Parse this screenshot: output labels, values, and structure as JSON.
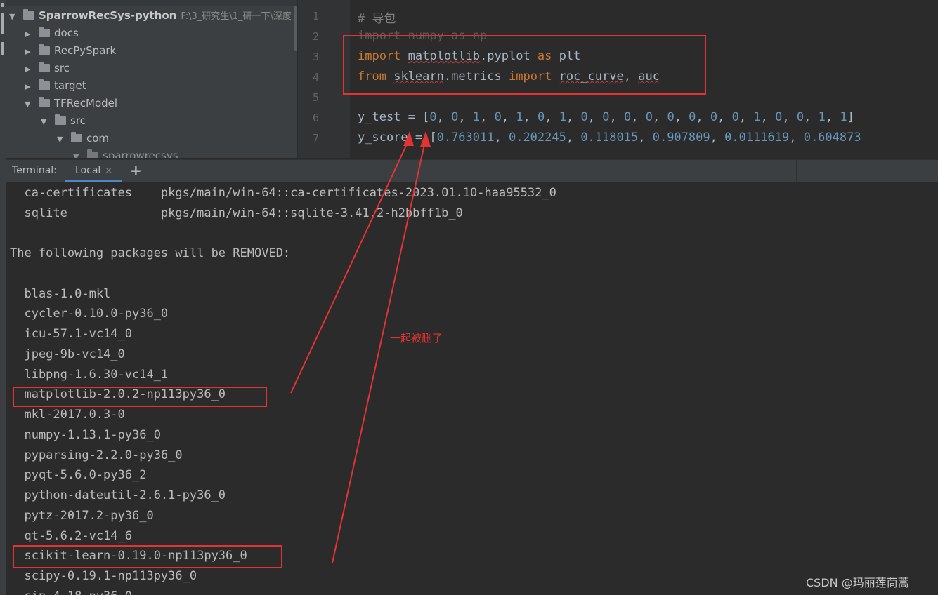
{
  "project_tree": {
    "root_name": "SparrowRecSys-python",
    "root_path": "F:\\3_研究生\\1_研一下\\深度",
    "items": [
      {
        "label": "docs"
      },
      {
        "label": "RecPySpark"
      },
      {
        "label": "src"
      },
      {
        "label": "target"
      },
      {
        "label": "TFRecModel"
      },
      {
        "label": "src"
      },
      {
        "label": "com"
      },
      {
        "label": "sparrowrecsys"
      }
    ]
  },
  "editor": {
    "line_numbers": [
      "1",
      "2",
      "3",
      "4",
      "5",
      "6",
      "7"
    ],
    "lines": [
      "# 导包",
      "import numpy as np",
      "import matplotlib.pyplot as plt",
      "from sklearn.metrics import roc_curve, auc",
      "",
      "y_test = [0, 0, 1, 0, 1, 0, 1, 0, 0, 0, 0, 0, 0, 0, 0, 1, 0, 0, 1, 1]",
      "y_score = [0.763011, 0.202245, 0.118015, 0.907809, 0.0111619, 0.604873"
    ]
  },
  "terminal": {
    "title": "Terminal:",
    "tab_label": "Local",
    "close_glyph": "×",
    "add_glyph": "+",
    "lines": [
      "  ca-certificates    pkgs/main/win-64::ca-certificates-2023.01.10-haa95532_0",
      "  sqlite             pkgs/main/win-64::sqlite-3.41.2-h2bbff1b_0",
      "",
      "The following packages will be REMOVED:",
      "",
      "  blas-1.0-mkl",
      "  cycler-0.10.0-py36_0",
      "  icu-57.1-vc14_0",
      "  jpeg-9b-vc14_0",
      "  libpng-1.6.30-vc14_1",
      "  matplotlib-2.0.2-np113py36_0",
      "  mkl-2017.0.3-0",
      "  numpy-1.13.1-py36_0",
      "  pyparsing-2.2.0-py36_0",
      "  pyqt-5.6.0-py36_2",
      "  python-dateutil-2.6.1-py36_0",
      "  pytz-2017.2-py36_0",
      "  qt-5.6.2-vc14_6",
      "  scikit-learn-0.19.0-np113py36_0",
      "  scipy-0.19.1-np113py36_0",
      "  sip-4.18-py36_0"
    ]
  },
  "annotation": "一起被删了",
  "watermark": "CSDN @玛丽莲茼蒿",
  "colors": {
    "highlight_box": "#e53333",
    "keyword": "#cc7832",
    "number": "#6897bb",
    "comment": "#808080"
  }
}
